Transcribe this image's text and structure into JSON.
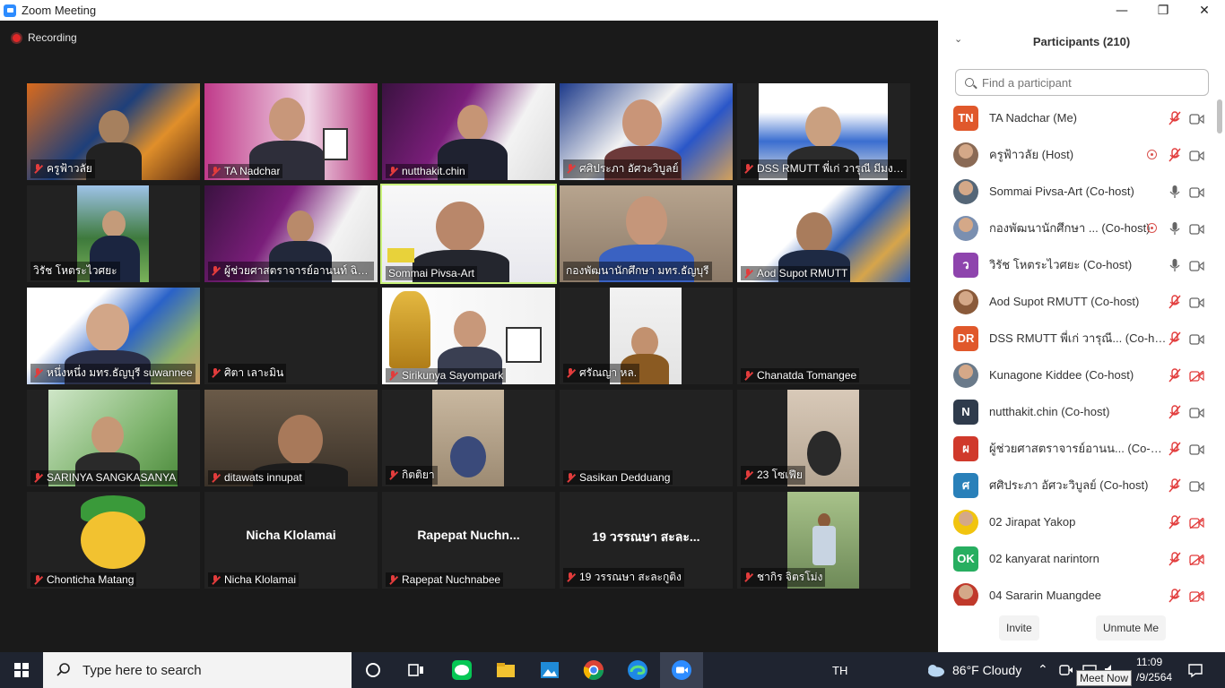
{
  "window": {
    "title": "Zoom Meeting",
    "controls": [
      "minimize-icon",
      "restore-icon",
      "close-icon"
    ]
  },
  "meeting": {
    "recording_label": "Recording",
    "tiles": [
      {
        "name": "ครูฟ้าวลัย",
        "muted": true
      },
      {
        "name": "TA Nadchar",
        "muted": true
      },
      {
        "name": "nutthakit.chin",
        "muted": true
      },
      {
        "name": "ศศิประภา อัศวะวิบูลย์",
        "muted": true
      },
      {
        "name": "DSS RMUTT พี่เก่ วารุณี มีมงบุ...",
        "muted": true
      },
      {
        "name": "วิรัช  โหตระไวศยะ",
        "muted": false
      },
      {
        "name": "ผู้ช่วยศาสตราจารย์อานนท์ ฉิมม...",
        "muted": true
      },
      {
        "name": "Sommai Pivsa-Art",
        "muted": false,
        "active": true
      },
      {
        "name": "กองพัฒนานักศึกษา มทร.ธัญบุรี",
        "muted": false
      },
      {
        "name": "Aod Supot RMUTT",
        "muted": true
      },
      {
        "name": "หนึ่งหนึ่ง มทร.ธัญบุรี suwannee",
        "muted": true
      },
      {
        "name": "ศิตา เลาะมิน",
        "muted": true
      },
      {
        "name": "Sirikunya Sayompark",
        "muted": true
      },
      {
        "name": "ศรัณญา หล.",
        "muted": true
      },
      {
        "name": "Chanatda Tomangee",
        "muted": true
      },
      {
        "name": "SARINYA SANGKASANYA",
        "muted": true
      },
      {
        "name": "ditawats innupat",
        "muted": true
      },
      {
        "name": "กิตติยา",
        "muted": true
      },
      {
        "name": "Sasikan Dedduang",
        "muted": true
      },
      {
        "name": "23 โซเฟีย",
        "muted": true
      },
      {
        "name": "Chonticha Matang",
        "muted": true
      },
      {
        "name": "Nicha Klolamai",
        "muted": true,
        "display_name": "Nicha Klolamai"
      },
      {
        "name": "Rapepat Nuchnabee",
        "muted": true,
        "display_name": "Rapepat  Nuchn..."
      },
      {
        "name": "19 วรรณษา สะละกูติง",
        "muted": true,
        "display_name": "19 วรรณษา สะละ..."
      },
      {
        "name": "ชากิร จิตรโม่ง",
        "muted": true
      }
    ]
  },
  "participants": {
    "title": "Participants (210)",
    "search_placeholder": "Find a participant",
    "items": [
      {
        "name": "TA Nadchar (Me)",
        "avatar": "TN",
        "color": "#e0582b",
        "mic": "muted",
        "cam": "on"
      },
      {
        "name": "ครูฟ้าวลัย (Host)",
        "avatar": "photo",
        "color": "#8a6a55",
        "mic": "muted",
        "cam": "on",
        "recording": true
      },
      {
        "name": "Sommai Pivsa-Art (Co-host)",
        "avatar": "photo",
        "color": "#556677",
        "mic": "on",
        "cam": "on"
      },
      {
        "name": "กองพัฒนานักศึกษา ...   (Co-host)",
        "avatar": "photo",
        "color": "#7a8fb0",
        "mic": "on",
        "cam": "on",
        "recording": true
      },
      {
        "name": "วิรัช  โหตระไวศยะ (Co-host)",
        "avatar": "ว",
        "color": "#8e44ad",
        "mic": "on",
        "cam": "on"
      },
      {
        "name": "Aod Supot RMUTT (Co-host)",
        "avatar": "photo",
        "color": "#8a5a3a",
        "mic": "muted",
        "cam": "on"
      },
      {
        "name": "DSS RMUTT พี่เก่ วารุณี...  (Co-host)",
        "avatar": "DR",
        "color": "#e0582b",
        "mic": "muted",
        "cam": "on"
      },
      {
        "name": "Kunagone Kiddee (Co-host)",
        "avatar": "photo",
        "color": "#6a7a8a",
        "mic": "muted",
        "cam": "off"
      },
      {
        "name": "nutthakit.chin (Co-host)",
        "avatar": "N",
        "color": "#2f3b4c",
        "mic": "muted",
        "cam": "on"
      },
      {
        "name": "ผู้ช่วยศาสตราจารย์อานน...  (Co-host)",
        "avatar": "ผ",
        "color": "#d0392b",
        "mic": "muted",
        "cam": "on"
      },
      {
        "name": "ศศิประภา อัศวะวิบูลย์ (Co-host)",
        "avatar": "ศ",
        "color": "#2980b9",
        "mic": "muted",
        "cam": "on"
      },
      {
        "name": "02 Jirapat Yakop",
        "avatar": "photo",
        "color": "#f1c40f",
        "mic": "muted",
        "cam": "off"
      },
      {
        "name": "02 kanyarat narintorn",
        "avatar": "OK",
        "color": "#27ae60",
        "mic": "muted",
        "cam": "off"
      },
      {
        "name": "04 Sararin Muangdee",
        "avatar": "photo",
        "color": "#c0392b",
        "mic": "muted",
        "cam": "off"
      }
    ],
    "invite_label": "Invite",
    "unmute_label": "Unmute Me"
  },
  "taskbar": {
    "search_placeholder": "Type here to search",
    "language": "TH",
    "weather": "86°F  Cloudy",
    "time": "11:09",
    "date": "/9/2564",
    "tooltip": "Meet Now"
  },
  "colors": {
    "meeting_bg": "#1a1a1a",
    "active_speaker": "#c9f27a",
    "muted_red": "#e23c3c",
    "taskbar_bg": "#1f2430",
    "zoom_blue": "#2d8cff"
  }
}
